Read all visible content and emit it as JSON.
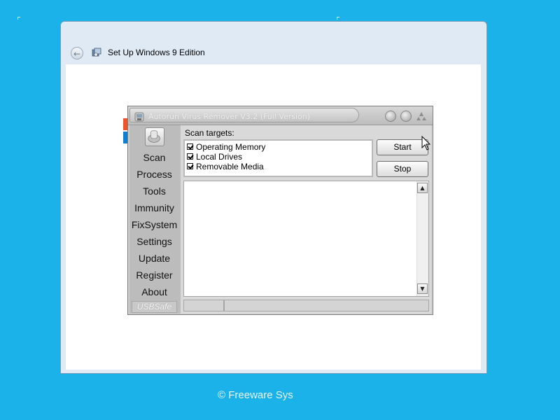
{
  "setup": {
    "title": "Set Up Windows 9 Edition",
    "back_icon": "back-arrow-icon"
  },
  "dialog": {
    "title": "Autorun Virus Remover V3.2 (Full Version)",
    "nav": [
      "Scan",
      "Process",
      "Tools",
      "Immunity",
      "FixSystem",
      "Settings",
      "Update",
      "Register",
      "About"
    ],
    "nav_footer": "USBSafe",
    "scan_label": "Scan targets:",
    "targets": [
      {
        "label": "Operating Memory",
        "checked": true
      },
      {
        "label": "Local Drives",
        "checked": true
      },
      {
        "label": "Removable Media",
        "checked": true
      }
    ],
    "start_label": "Start",
    "stop_label": "Stop",
    "status": [
      "",
      ""
    ]
  },
  "footer": {
    "copyright_symbol": "©",
    "text": "Freeware Sys"
  },
  "colors": {
    "desktop": "#1ab2e8",
    "dialog_gray": "#cfcfcf"
  }
}
